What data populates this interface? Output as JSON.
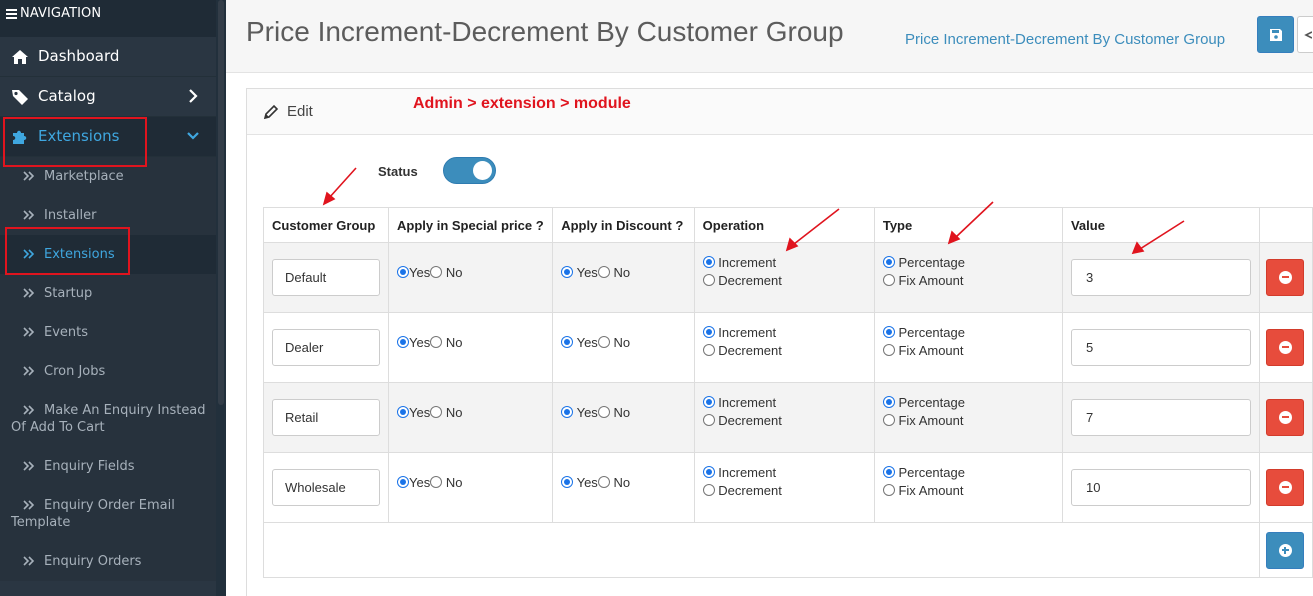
{
  "nav": {
    "heading": "NAVIGATION",
    "menu": [
      {
        "label": "Dashboard",
        "icon": "home-icon"
      },
      {
        "label": "Catalog",
        "icon": "tag-icon"
      },
      {
        "label": "Extensions",
        "icon": "puzzle-icon",
        "active": true
      }
    ],
    "submenu": [
      {
        "label": "Marketplace"
      },
      {
        "label": "Installer"
      },
      {
        "label": "Extensions",
        "active": true
      },
      {
        "label": "Startup"
      },
      {
        "label": "Events"
      },
      {
        "label": "Cron Jobs"
      },
      {
        "label": "Make An Enquiry Instead Of Add To Cart"
      },
      {
        "label": "Enquiry Fields"
      },
      {
        "label": "Enquiry Order Email Template"
      },
      {
        "label": "Enquiry Orders"
      }
    ]
  },
  "header": {
    "title": "Price Increment-Decrement By Customer Group",
    "breadcrumb": "Price Increment-Decrement By Customer Group"
  },
  "panel": {
    "title": "Edit",
    "annotation": "Admin > extension > module",
    "status_label": "Status",
    "status_on": true
  },
  "table": {
    "columns": [
      "Customer Group",
      "Apply in Special price ?",
      "Apply in Discount ?",
      "Operation",
      "Type",
      "Value"
    ],
    "yes_label": "Yes",
    "no_label": "No",
    "op_increment": "Increment",
    "op_decrement": "Decrement",
    "type_percentage": "Percentage",
    "type_fix": "Fix Amount",
    "rows": [
      {
        "group": "Default",
        "special": "Yes",
        "discount": "Yes",
        "operation": "Increment",
        "type": "Percentage",
        "value": "3"
      },
      {
        "group": "Dealer",
        "special": "Yes",
        "discount": "Yes",
        "operation": "Increment",
        "type": "Percentage",
        "value": "5"
      },
      {
        "group": "Retail",
        "special": "Yes",
        "discount": "Yes",
        "operation": "Increment",
        "type": "Percentage",
        "value": "7"
      },
      {
        "group": "Wholesale",
        "special": "Yes",
        "discount": "Yes",
        "operation": "Increment",
        "type": "Percentage",
        "value": "10"
      }
    ]
  },
  "colors": {
    "accent": "#3c8dbc",
    "danger": "#e74c3c",
    "annotation": "#e0141e",
    "sidebar": "#2a3642"
  }
}
